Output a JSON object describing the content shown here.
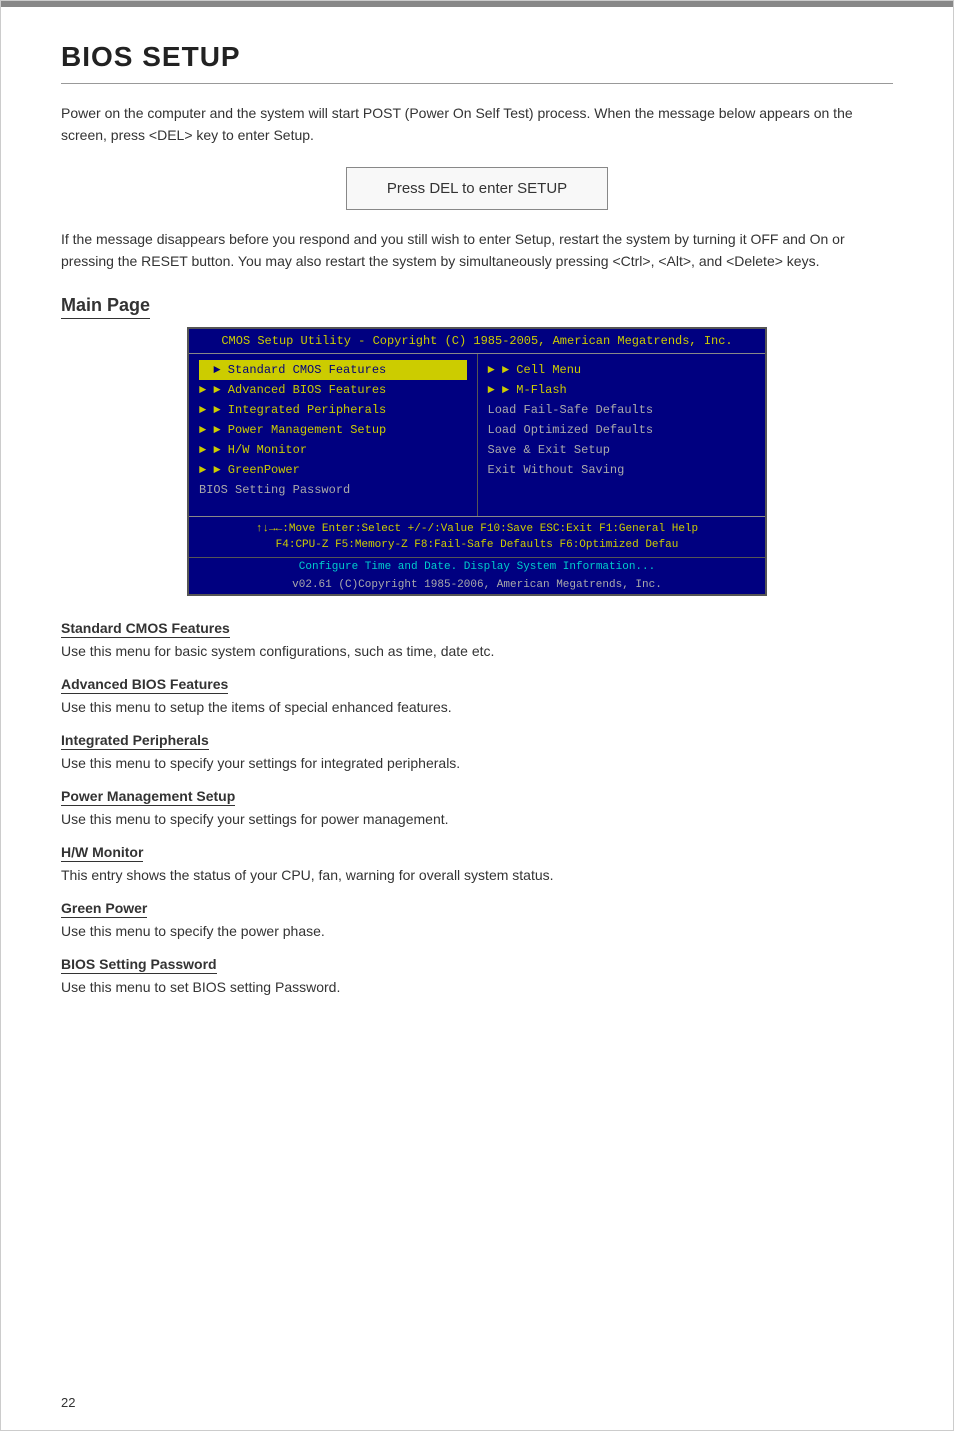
{
  "page": {
    "number": "22",
    "title": "BIOS SETUP",
    "intro": "Power on the computer and the system will start POST (Power On Self Test) process. When the message below appears on the screen, press <DEL> key to enter Setup.",
    "press_del_message": "Press DEL to enter SETUP",
    "after_del_text": "If the message disappears before you respond and you still wish to enter Setup, restart the system by turning it OFF and On or pressing the RESET button. You may also restart the system by simultaneously pressing <Ctrl>, <Alt>, and <Delete> keys.",
    "main_page_title": "Main Page"
  },
  "bios_screen": {
    "header": "CMOS Setup Utility - Copyright (C) 1985-2005, American Megatrends, Inc.",
    "left_menu": [
      {
        "label": "Standard CMOS Features",
        "arrow": true,
        "active": true
      },
      {
        "label": "Advanced BIOS Features",
        "arrow": true,
        "active": false
      },
      {
        "label": "Integrated Peripherals",
        "arrow": true,
        "active": false
      },
      {
        "label": "Power Management Setup",
        "arrow": true,
        "active": false
      },
      {
        "label": "H/W Monitor",
        "arrow": true,
        "active": false
      },
      {
        "label": "GreenPower",
        "arrow": true,
        "active": false
      },
      {
        "label": "BIOS Setting Password",
        "arrow": false,
        "active": false
      }
    ],
    "right_menu": [
      {
        "label": "Cell Menu",
        "arrow": true,
        "active": false
      },
      {
        "label": "M-Flash",
        "arrow": true,
        "active": false
      },
      {
        "label": "Load Fail-Safe Defaults",
        "arrow": false,
        "active": false
      },
      {
        "label": "Load Optimized Defaults",
        "arrow": false,
        "active": false
      },
      {
        "label": "Save & Exit Setup",
        "arrow": false,
        "active": false
      },
      {
        "label": "Exit Without Saving",
        "arrow": false,
        "active": false
      }
    ],
    "footer_line1": "↑↓→←:Move  Enter:Select  +/-/:Value  F10:Save  ESC:Exit  F1:General Help",
    "footer_line2": "F4:CPU-Z    F5:Memory-Z    F8:Fail-Safe Defaults    F6:Optimized Defau",
    "status_line": "Configure Time and Date.  Display System Information...",
    "version_line": "v02.61 (C)Copyright 1985-2006, American Megatrends, Inc."
  },
  "menu_descriptions": [
    {
      "title": "Standard CMOS Features",
      "desc": "Use this menu for basic system configurations, such as time, date etc."
    },
    {
      "title": "Advanced BIOS Features",
      "desc": "Use this menu to setup the items of special enhanced features."
    },
    {
      "title": "Integrated Peripherals",
      "desc": "Use this menu to specify your settings for integrated peripherals."
    },
    {
      "title": "Power Management Setup",
      "desc": "Use this menu to specify your settings for power management."
    },
    {
      "title": "H/W Monitor",
      "desc": "This entry shows the status of your CPU, fan, warning for overall system status."
    },
    {
      "title": "Green Power",
      "desc": "Use this menu to specify the power phase."
    },
    {
      "title": "BIOS Setting Password",
      "desc": "Use this menu to set BIOS setting Password."
    }
  ]
}
